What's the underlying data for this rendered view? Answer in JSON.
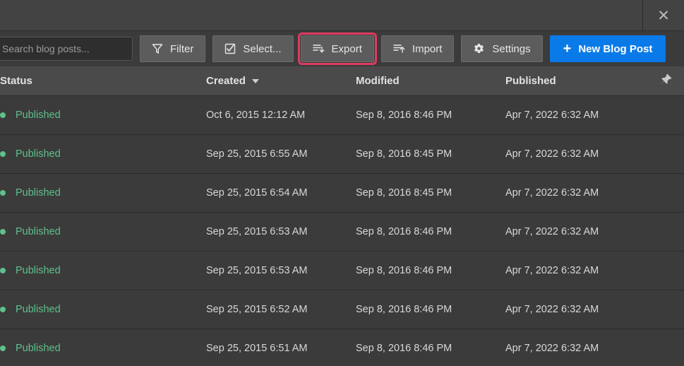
{
  "window": {
    "close_label": "✕"
  },
  "toolbar": {
    "search": {
      "value": "",
      "placeholder": "Search blog posts..."
    },
    "buttons": [
      {
        "label": "Filter",
        "icon": "filter-icon"
      },
      {
        "label": "Select...",
        "icon": "checkbox-icon"
      },
      {
        "label": "Export",
        "icon": "export-icon"
      },
      {
        "label": "Import",
        "icon": "import-icon"
      },
      {
        "label": "Settings",
        "icon": "gear-icon"
      },
      {
        "label": "New Blog Post",
        "icon": "plus-icon"
      }
    ],
    "highlighted_button": "Export",
    "highlight_color": "#e03a5f",
    "primary_color": "#0a7ae8"
  },
  "table": {
    "columns": [
      {
        "key": "status",
        "label": "Status",
        "sorted": false
      },
      {
        "key": "created",
        "label": "Created",
        "sorted": true
      },
      {
        "key": "modified",
        "label": "Modified",
        "sorted": false
      },
      {
        "key": "published",
        "label": "Published",
        "sorted": false
      }
    ],
    "pin_icon": "pin-icon",
    "status_color": "#5fc08b",
    "rows": [
      {
        "status": "Published",
        "created": "Oct 6, 2015 12:12 AM",
        "modified": "Sep 8, 2016 8:46 PM",
        "published": "Apr 7, 2022 6:32 AM"
      },
      {
        "status": "Published",
        "created": "Sep 25, 2015 6:55 AM",
        "modified": "Sep 8, 2016 8:45 PM",
        "published": "Apr 7, 2022 6:32 AM"
      },
      {
        "status": "Published",
        "created": "Sep 25, 2015 6:54 AM",
        "modified": "Sep 8, 2016 8:45 PM",
        "published": "Apr 7, 2022 6:32 AM"
      },
      {
        "status": "Published",
        "created": "Sep 25, 2015 6:53 AM",
        "modified": "Sep 8, 2016 8:46 PM",
        "published": "Apr 7, 2022 6:32 AM"
      },
      {
        "status": "Published",
        "created": "Sep 25, 2015 6:53 AM",
        "modified": "Sep 8, 2016 8:46 PM",
        "published": "Apr 7, 2022 6:32 AM"
      },
      {
        "status": "Published",
        "created": "Sep 25, 2015 6:52 AM",
        "modified": "Sep 8, 2016 8:46 PM",
        "published": "Apr 7, 2022 6:32 AM"
      },
      {
        "status": "Published",
        "created": "Sep 25, 2015 6:51 AM",
        "modified": "Sep 8, 2016 8:46 PM",
        "published": "Apr 7, 2022 6:32 AM"
      }
    ]
  }
}
